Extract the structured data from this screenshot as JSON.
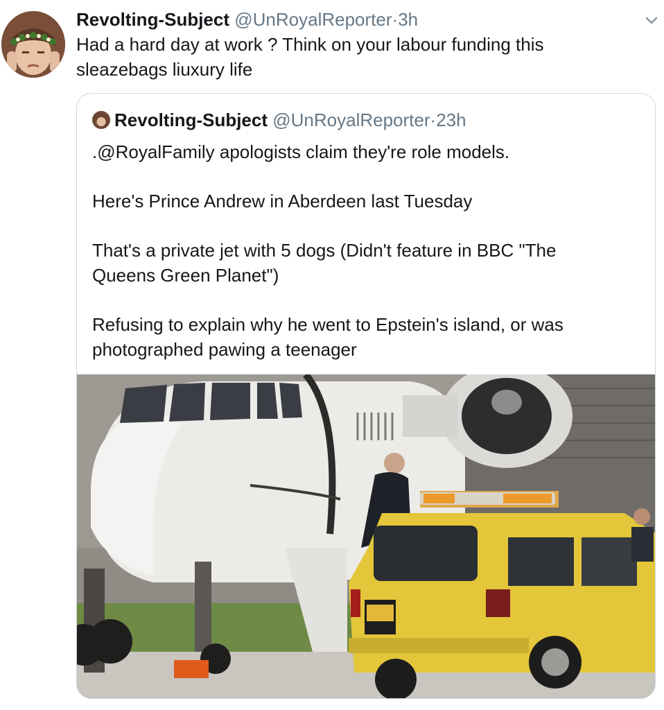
{
  "tweet": {
    "author_name": "Revolting-Subject",
    "author_handle": "@UnRoyalReporter",
    "separator": "·",
    "timestamp": "3h",
    "text_lines": [
      "Had a hard day at work ? Think on your labour funding this",
      "sleazebags liuxury life"
    ]
  },
  "quoted_tweet": {
    "author_name": "Revolting-Subject",
    "author_handle": "@UnRoyalReporter",
    "separator": "·",
    "timestamp": "23h",
    "paragraphs": [
      [
        ".@RoyalFamily apologists claim they're role models."
      ],
      [
        "Here's Prince Andrew in Aberdeen last Tuesday"
      ],
      [
        "That's a  private jet with 5 dogs (Didn't feature in BBC \"The",
        "Queens Green Planet\")"
      ],
      [
        "Refusing to explain why he went to Epstein's island, or was",
        "photographed pawing a teenager"
      ]
    ]
  },
  "icons": {
    "menu": "chevron-down-icon"
  },
  "colors": {
    "secondary_text": "#657786",
    "border": "#ccd6dd",
    "vehicle_yellow": "#e3c63a"
  }
}
